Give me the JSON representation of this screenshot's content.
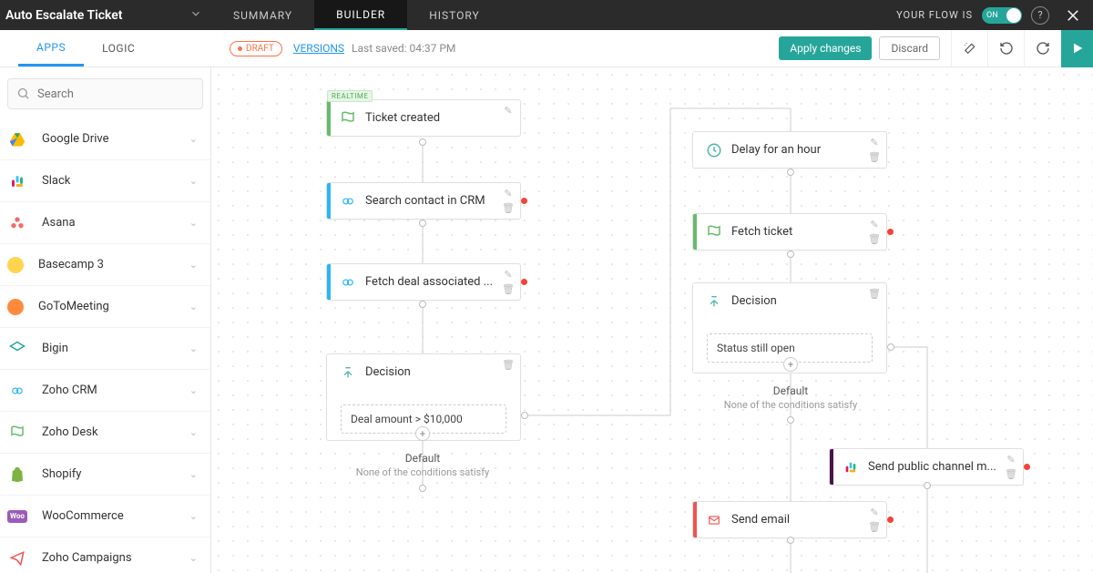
{
  "header": {
    "flow_title": "Auto Escalate Ticket",
    "tabs": {
      "summary": "SUMMARY",
      "builder": "BUILDER",
      "history": "HISTORY"
    },
    "status_label": "YOUR FLOW IS",
    "toggle_state": "ON"
  },
  "subbar": {
    "tabs": {
      "apps": "APPS",
      "logic": "LOGIC"
    },
    "draft_label": "DRAFT",
    "versions_label": "VERSIONS",
    "last_saved": "Last saved: 04:37 PM",
    "apply_label": "Apply changes",
    "discard_label": "Discard"
  },
  "sidebar": {
    "search_placeholder": "Search",
    "apps": [
      {
        "name": "Google Drive"
      },
      {
        "name": "Slack"
      },
      {
        "name": "Asana"
      },
      {
        "name": "Basecamp 3"
      },
      {
        "name": "GoToMeeting"
      },
      {
        "name": "Bigin"
      },
      {
        "name": "Zoho CRM"
      },
      {
        "name": "Zoho Desk"
      },
      {
        "name": "Shopify"
      },
      {
        "name": "WooCommerce"
      },
      {
        "name": "Zoho Campaigns"
      }
    ]
  },
  "canvas": {
    "realtime_tag": "REALTIME",
    "nodes": {
      "ticket_created": "Ticket created",
      "search_contact": "Search contact in CRM",
      "fetch_deal": "Fetch deal associated ...",
      "decision_left": "Decision",
      "deal_amount_cond": "Deal amount > $10,000",
      "default_left": "Default",
      "default_sub_left": "None of the conditions satisfy",
      "delay_hour": "Delay for an hour",
      "fetch_ticket": "Fetch ticket",
      "decision_right": "Decision",
      "status_open_cond": "Status still open",
      "default_right": "Default",
      "default_sub_right": "None of the conditions satisfy",
      "send_slack": "Send public channel m...",
      "send_email": "Send email"
    }
  }
}
